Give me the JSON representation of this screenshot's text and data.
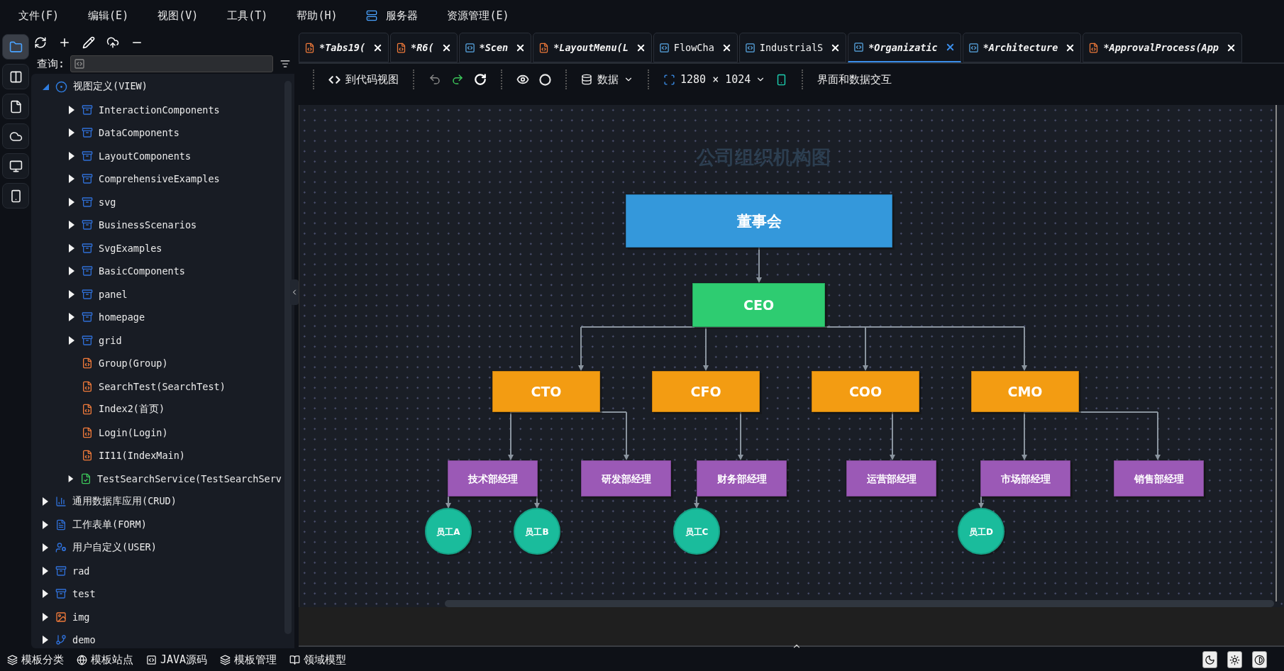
{
  "menu": [
    {
      "kind": "menu",
      "label": "文件(F)"
    },
    {
      "kind": "menu",
      "label": "编辑(E)"
    },
    {
      "kind": "menu",
      "label": "视图(V)"
    },
    {
      "kind": "menu",
      "label": "工具(T)"
    },
    {
      "kind": "menu",
      "label": "帮助(H)"
    },
    {
      "kind": "server",
      "label": "服务器"
    },
    {
      "kind": "menu",
      "label": "资源管理(E)"
    }
  ],
  "rail": [
    {
      "selected": true
    },
    {
      "selected": false
    },
    {
      "selected": false
    },
    {
      "selected": false
    },
    {
      "selected": false
    },
    {
      "selected": false
    }
  ],
  "sidebar": {
    "search_label": "查询:",
    "tree": [
      {
        "kind": "view",
        "label": "视图定义(VIEW)",
        "expanded": true,
        "children": [
          {
            "kind": "folder",
            "label": "InteractionComponents",
            "expanded": false
          },
          {
            "kind": "folder",
            "label": "DataComponents",
            "expanded": false
          },
          {
            "kind": "folder",
            "label": "LayoutComponents",
            "expanded": false
          },
          {
            "kind": "folder",
            "label": "ComprehensiveExamples",
            "expanded": false
          },
          {
            "kind": "folder",
            "label": "svg",
            "expanded": false
          },
          {
            "kind": "folder",
            "label": "BusinessScenarios",
            "expanded": false
          },
          {
            "kind": "folder",
            "label": "SvgExamples",
            "expanded": false
          },
          {
            "kind": "folder",
            "label": "BasicComponents",
            "expanded": false
          },
          {
            "kind": "folder",
            "label": "panel",
            "expanded": false
          },
          {
            "kind": "folder",
            "label": "homepage",
            "expanded": false
          },
          {
            "kind": "folder",
            "label": "grid",
            "expanded": false
          },
          {
            "kind": "page",
            "label": "Group(Group)"
          },
          {
            "kind": "page",
            "label": "SearchTest(SearchTest)"
          },
          {
            "kind": "page",
            "label": "Index2(首页)"
          },
          {
            "kind": "page",
            "label": "Login(Login)"
          },
          {
            "kind": "page",
            "label": "II11(IndexMain)"
          },
          {
            "kind": "service",
            "label": "TestSearchService(TestSearchServ",
            "expanded": false
          }
        ]
      },
      {
        "kind": "crud",
        "label": "通用数据库应用(CRUD)",
        "expanded": false
      },
      {
        "kind": "form",
        "label": "工作表单(FORM)",
        "expanded": false
      },
      {
        "kind": "user",
        "label": "用户自定义(USER)",
        "expanded": false
      },
      {
        "kind": "folder",
        "label": "rad",
        "expanded": false
      },
      {
        "kind": "folder",
        "label": "test",
        "expanded": false
      },
      {
        "kind": "image",
        "label": "img",
        "expanded": false
      },
      {
        "kind": "branch",
        "label": "demo",
        "expanded": false
      }
    ]
  },
  "tabs": [
    {
      "kind": "html",
      "label": "*Tabs19(",
      "modified": true,
      "selected": false
    },
    {
      "kind": "html",
      "label": "*R6(",
      "modified": true,
      "selected": false
    },
    {
      "kind": "js",
      "label": "*Scen",
      "modified": true,
      "selected": false
    },
    {
      "kind": "html",
      "label": "*LayoutMenu(L",
      "modified": true,
      "selected": false
    },
    {
      "kind": "js",
      "label": "FlowCha",
      "modified": false,
      "selected": false
    },
    {
      "kind": "js",
      "label": "IndustrialS",
      "modified": false,
      "selected": false
    },
    {
      "kind": "js",
      "label": "*Organizatic",
      "modified": true,
      "selected": true
    },
    {
      "kind": "js",
      "label": "*Architecture",
      "modified": true,
      "selected": false
    },
    {
      "kind": "html",
      "label": "*ApprovalProcess(App",
      "modified": true,
      "selected": false
    }
  ],
  "toolbar": {
    "code_view": "到代码视图",
    "data": "数据",
    "size": "1280 × 1024",
    "interaction": "界面和数据交互"
  },
  "canvas": {
    "title": "公司组织机构图",
    "org": {
      "kind": "board",
      "label": "董事会",
      "children": [
        {
          "kind": "officer",
          "label": "CEO",
          "children": [
            {
              "kind": "officer",
              "label": "CTO",
              "children": [
                {
                  "kind": "manager",
                  "label": "技术部经理",
                  "children": [
                    {
                      "kind": "employee",
                      "label": "员工A"
                    },
                    {
                      "kind": "employee",
                      "label": "员工B"
                    }
                  ]
                },
                {
                  "kind": "manager",
                  "label": "研发部经理"
                }
              ]
            },
            {
              "kind": "officer",
              "label": "CFO",
              "children": [
                {
                  "kind": "manager",
                  "label": "财务部经理",
                  "children": [
                    {
                      "kind": "employee",
                      "label": "员工C"
                    }
                  ]
                }
              ]
            },
            {
              "kind": "officer",
              "label": "COO",
              "children": [
                {
                  "kind": "manager",
                  "label": "运营部经理"
                }
              ]
            },
            {
              "kind": "officer",
              "label": "CMO",
              "children": [
                {
                  "kind": "manager",
                  "label": "市场部经理",
                  "children": [
                    {
                      "kind": "employee",
                      "label": "员工D"
                    }
                  ]
                },
                {
                  "kind": "manager",
                  "label": "销售部经理"
                }
              ]
            }
          ]
        }
      ]
    }
  },
  "status_bar": [
    {
      "label": "模板分类"
    },
    {
      "label": "模板站点"
    },
    {
      "label": "JAVA源码"
    },
    {
      "label": "模板管理"
    },
    {
      "label": "领域模型"
    }
  ]
}
